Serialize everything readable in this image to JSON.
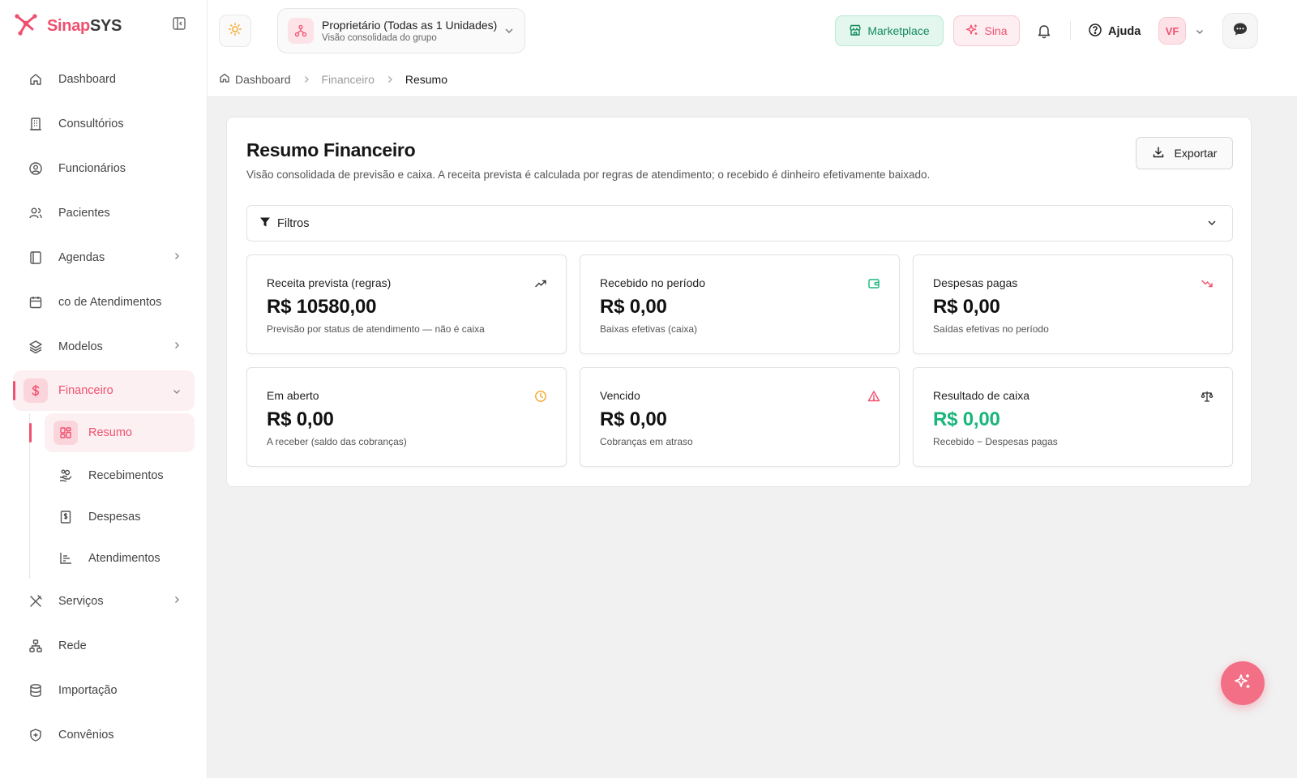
{
  "brand": {
    "name_part1": "Sinap",
    "name_part2": "SYS",
    "logo_icon": "sinapsys-logo-icon"
  },
  "sidebar": {
    "items": [
      {
        "label": "Dashboard",
        "icon": "home-icon"
      },
      {
        "label": "Consultórios",
        "icon": "building-icon"
      },
      {
        "label": "Funcionários",
        "icon": "user-circle-icon"
      },
      {
        "label": "Pacientes",
        "icon": "users-icon"
      },
      {
        "label": "Agendas",
        "icon": "book-icon",
        "has_children": true
      },
      {
        "label": "co de Atendimentos",
        "icon": "calendar-icon"
      },
      {
        "label": "Modelos",
        "icon": "layers-icon",
        "has_children": true
      },
      {
        "label": "Financeiro",
        "icon": "dollar-icon",
        "expanded": true,
        "active": true
      },
      {
        "label": "Serviços",
        "icon": "tools-icon",
        "has_children": true
      },
      {
        "label": "Rede",
        "icon": "network-icon"
      },
      {
        "label": "Importação",
        "icon": "database-icon"
      },
      {
        "label": "Convênios",
        "icon": "shield-icon"
      }
    ],
    "financeiro_sub": [
      {
        "label": "Resumo",
        "icon": "grid-icon",
        "active": true
      },
      {
        "label": "Recebimentos",
        "icon": "hand-coins-icon"
      },
      {
        "label": "Despesas",
        "icon": "receipt-icon"
      },
      {
        "label": "Atendimentos",
        "icon": "bar-chart-icon"
      }
    ]
  },
  "topbar": {
    "unit_title": "Proprietário (Todas as 1 Unidades)",
    "unit_subtitle": "Visão consolidada do grupo",
    "marketplace_label": "Marketplace",
    "sina_label": "Sina",
    "help_label": "Ajuda",
    "avatar_initials": "VF"
  },
  "breadcrumb": [
    "Dashboard",
    "Financeiro",
    "Resumo"
  ],
  "page": {
    "title": "Resumo Financeiro",
    "description": "Visão consolidada de previsão e caixa. A receita prevista é calculada por regras de atendimento; o recebido é dinheiro efetivamente baixado.",
    "export_label": "Exportar",
    "filters_label": "Filtros"
  },
  "cards": [
    {
      "title": "Receita prevista (regras)",
      "value": "R$ 10580,00",
      "sub": "Previsão por status de atendimento — não é caixa",
      "icon": "trending-up-icon",
      "icon_color": "#333333"
    },
    {
      "title": "Recebido no período",
      "value": "R$ 0,00",
      "sub": "Baixas efetivas (caixa)",
      "icon": "wallet-icon",
      "icon_color": "#19b67b"
    },
    {
      "title": "Despesas pagas",
      "value": "R$ 0,00",
      "sub": "Saídas efetivas no período",
      "icon": "trending-down-icon",
      "icon_color": "#f0506e"
    },
    {
      "title": "Em aberto",
      "value": "R$ 0,00",
      "sub": "A receber (saldo das cobranças)",
      "icon": "clock-icon",
      "icon_color": "#f5a524"
    },
    {
      "title": "Vencido",
      "value": "R$ 0,00",
      "sub": "Cobranças em atraso",
      "icon": "alert-triangle-icon",
      "icon_color": "#f0506e"
    },
    {
      "title": "Resultado de caixa",
      "value": "R$ 0,00",
      "sub": "Recebido − Despesas pagas",
      "icon": "scale-icon",
      "icon_color": "#333333",
      "value_color": "#19b67b"
    }
  ],
  "colors": {
    "accent": "#f0506e",
    "green": "#19b67b",
    "amber": "#f5a524"
  }
}
